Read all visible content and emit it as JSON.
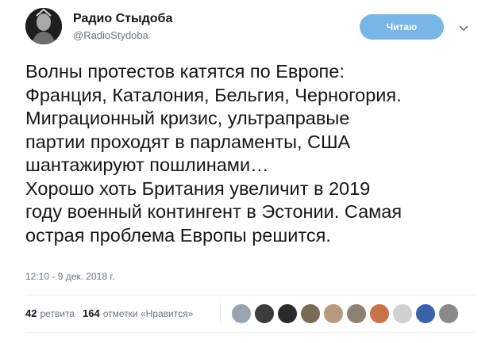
{
  "account": {
    "display_name": "Радио Стыдоба",
    "handle": "@RadioStydoba",
    "avatar_icon": "statue-avatar-icon"
  },
  "follow_button": {
    "label": "Читаю",
    "color": "#78b6e8"
  },
  "tweet": {
    "text": "Волны протестов катятся по Европе:\nФранция, Каталония, Бельгия, Черногория.\nМиграционный кризис, ультраправые\nпартии проходят в парламенты, США\nшантажируют пошлинами…\nХорошо хоть Британия увеличит в 2019\nгоду военный контингент в Эстонии. Самая\nострая проблема Европы решится.",
    "timestamp": "12:10 - 9 дек. 2018 г."
  },
  "stats": {
    "retweets_count": "42",
    "retweets_label": "ретвита",
    "likes_count": "164",
    "likes_label": "отметки «Нравится»"
  },
  "likers": [
    {
      "color": "#9aa4b0"
    },
    {
      "color": "#3c3c3c"
    },
    {
      "color": "#2b2b2b"
    },
    {
      "color": "#7a6a58"
    },
    {
      "color": "#b59a7e"
    },
    {
      "color": "#8c8070"
    },
    {
      "color": "#c9734a"
    },
    {
      "color": "#d0d0d0"
    },
    {
      "color": "#3a62a8"
    },
    {
      "color": "#8a8a8a"
    }
  ]
}
